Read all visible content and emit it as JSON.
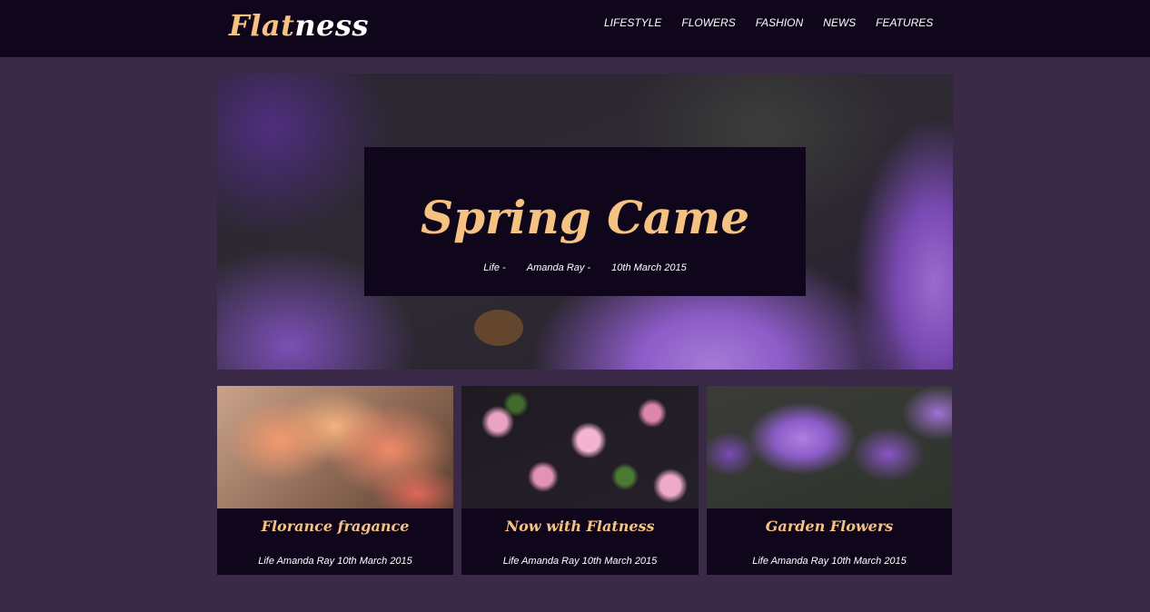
{
  "header": {
    "logo_part1": "Flat",
    "logo_part2": "ness",
    "nav": [
      "LIFESTYLE",
      "FLOWERS",
      "FASHION",
      "NEWS",
      "FEATURES"
    ]
  },
  "hero": {
    "title": "Spring Came",
    "category": "Life -",
    "author": "Amanda Ray -",
    "date": "10th March 2015"
  },
  "cards": [
    {
      "title": "Florance fragance",
      "meta": "Life Amanda Ray 10th March 2015"
    },
    {
      "title": "Now with Flatness",
      "meta": "Life Amanda Ray 10th March 2015"
    },
    {
      "title": "Garden Flowers",
      "meta": "Life Amanda Ray 10th March 2015"
    }
  ],
  "colors": {
    "background": "#3b2a47",
    "dark_panel": "#10061c",
    "accent": "#f6c281",
    "text": "#ffffff"
  }
}
